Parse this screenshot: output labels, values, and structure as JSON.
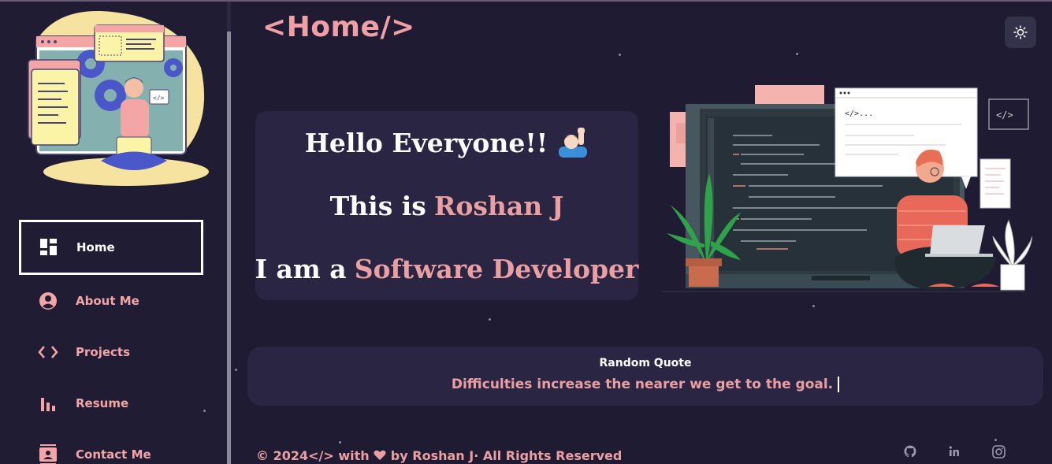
{
  "header": {
    "title": "<Home/>"
  },
  "sidebar": {
    "items": [
      {
        "label": "Home",
        "icon": "dashboard-icon",
        "active": true
      },
      {
        "label": "About Me",
        "icon": "account-circle-icon",
        "active": false
      },
      {
        "label": "Projects",
        "icon": "code-icon",
        "active": false
      },
      {
        "label": "Resume",
        "icon": "bar-chart-icon",
        "active": false
      },
      {
        "label": "Contact Me",
        "icon": "contact-card-icon",
        "active": false
      }
    ]
  },
  "hello": {
    "line1": "Hello Everyone!!",
    "line2_prefix": "This is",
    "line2_name": "Roshan J",
    "line3_prefix": "I am a",
    "line3_role": "Software Developer"
  },
  "illustration": {
    "code_tag": "</>",
    "snippet_label": "</>..."
  },
  "quote": {
    "title": "Random Quote",
    "text": "Difficulties increase the nearer we get to the goal."
  },
  "footer": {
    "copyright": "© 2024</> with",
    "byline": "by Roshan J· All Rights Reserved",
    "socials": [
      "github-icon",
      "linkedin-icon",
      "instagram-icon"
    ]
  },
  "colors": {
    "background": "#1e1b32",
    "card": "#2a2543",
    "accent_pink": "#eaa0a2",
    "text_white": "#ffffff"
  }
}
